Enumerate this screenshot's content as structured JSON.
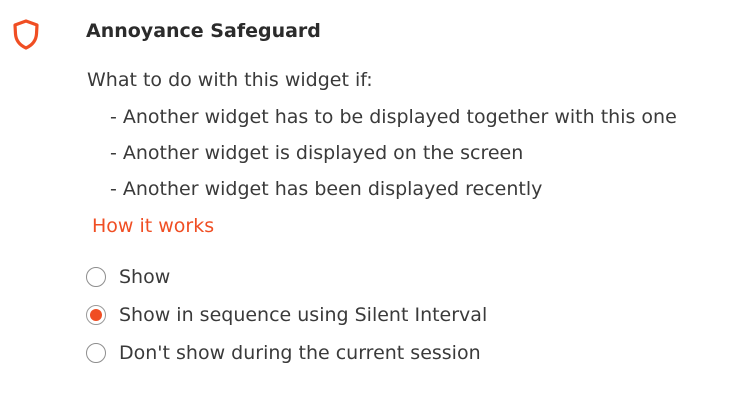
{
  "section": {
    "icon": "shield-icon",
    "title": "Annoyance Safeguard",
    "intro": "What to do with this widget if:",
    "conditions": [
      "- Another widget has to be displayed together with this one",
      "- Another widget is displayed on the screen",
      "- Another widget has been displayed recently"
    ],
    "how_it_works_label": "How it works"
  },
  "options": [
    {
      "label": "Show",
      "selected": false
    },
    {
      "label": "Show in sequence using Silent Interval",
      "selected": true
    },
    {
      "label": "Don't show during the current session",
      "selected": false
    }
  ],
  "colors": {
    "accent": "#f04e23",
    "text": "#3a3a3a"
  }
}
